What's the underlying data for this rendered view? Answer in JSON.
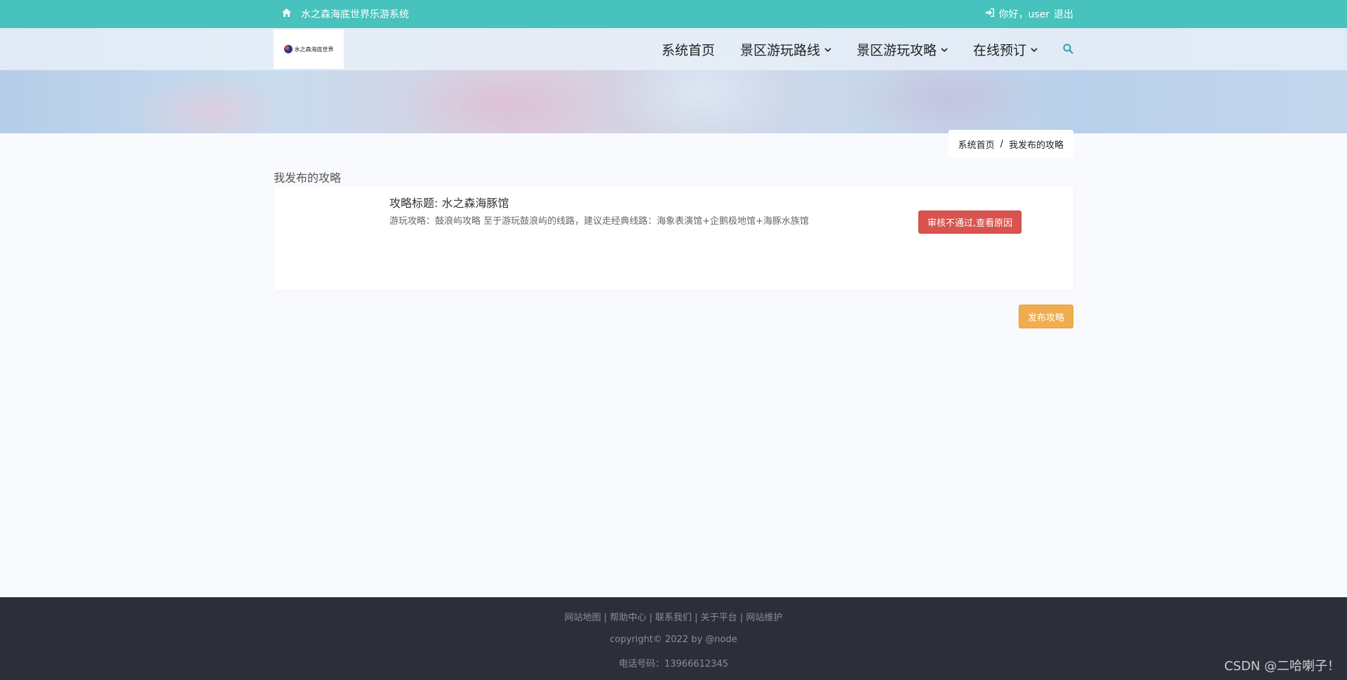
{
  "topbar": {
    "home_icon": "home-icon",
    "site_title": "水之森海底世界乐游系统",
    "login_icon": "sign-in-icon",
    "greeting": "你好，user",
    "logout": "退出"
  },
  "header": {
    "nav": [
      {
        "label": "系统首页",
        "dropdown": false
      },
      {
        "label": "景区游玩路线",
        "dropdown": true
      },
      {
        "label": "景区游玩攻略",
        "dropdown": true
      },
      {
        "label": "在线预订",
        "dropdown": true
      }
    ],
    "search_icon": "search-icon"
  },
  "breadcrumb": {
    "home": "系统首页",
    "separator": "/",
    "current": "我发布的攻略"
  },
  "main": {
    "section_title": "我发布的攻略",
    "posts": [
      {
        "title": "攻略标题: 水之森海豚馆",
        "description": "游玩攻略：鼓浪屿攻略 至于游玩鼓浪屿的线路，建议走经典线路：海象表演馆+企鹅极地馆+海豚水族馆",
        "status_button": "审核不通过,查看原因"
      }
    ],
    "publish_button": "发布攻略"
  },
  "footer": {
    "links": [
      "网站地图",
      "帮助中心",
      "联系我们",
      "关于平台",
      "网站维护"
    ],
    "copyright": "copyright© 2022 by @node",
    "phone": "电话号码：13966612345"
  },
  "watermark": "CSDN @二哈喇子！",
  "colors": {
    "topbar": "#47c2bd",
    "danger": "#d9534f",
    "warning": "#f0ad4e",
    "footer": "#2c2f3a"
  }
}
